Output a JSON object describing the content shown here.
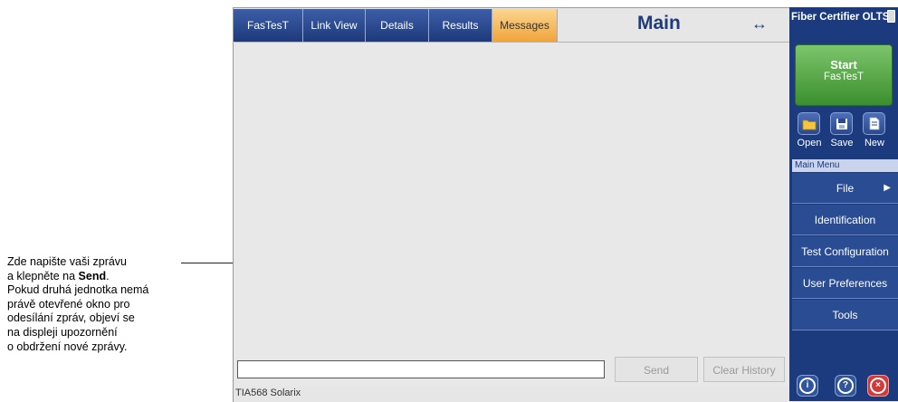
{
  "annotation": {
    "lines": [
      "Zde napište vaši zprávu",
      "a klepněte na ",
      "Send",
      ".",
      "Pokud druhá jednotka nemá",
      "právě otevřené okno pro",
      "odesílání zpráv, objeví se",
      "na displeji upozornění",
      "o obdržení nové zprávy."
    ]
  },
  "tabs": [
    {
      "label": "FasTesT"
    },
    {
      "label": "Link View"
    },
    {
      "label": "Details"
    },
    {
      "label": "Results"
    },
    {
      "label": "Messages",
      "active": true
    }
  ],
  "header": {
    "title": "Main",
    "arrow": "↔"
  },
  "message": {
    "input_value": "",
    "send_label": "Send",
    "clear_label": "Clear History"
  },
  "status": {
    "standard": "TIA568 Solarix"
  },
  "right_panel": {
    "app_title": "Fiber Certifier OLTS",
    "start": {
      "line1": "Start",
      "line2": "FasTesT"
    },
    "file_buttons": [
      {
        "label": "Open",
        "icon": "folder-icon"
      },
      {
        "label": "Save",
        "icon": "floppy-icon"
      },
      {
        "label": "New",
        "icon": "document-icon"
      }
    ],
    "menu_title": "Main Menu",
    "menu_items": [
      {
        "label": "File",
        "submenu": "▶"
      },
      {
        "label": "Identification"
      },
      {
        "label": "Test Configuration"
      },
      {
        "label": "User Preferences"
      },
      {
        "label": "Tools"
      }
    ],
    "bottom_buttons": [
      {
        "icon": "info-icon",
        "glyph": "i"
      },
      {
        "icon": "help-icon",
        "glyph": "?"
      },
      {
        "icon": "close-icon",
        "glyph": "×"
      }
    ]
  },
  "colors": {
    "panel": "#1c3b7f",
    "tab": "#2b4a8c",
    "tab_active": "#f5b85a",
    "start": "#4ba33b",
    "close": "#d23a3a"
  }
}
